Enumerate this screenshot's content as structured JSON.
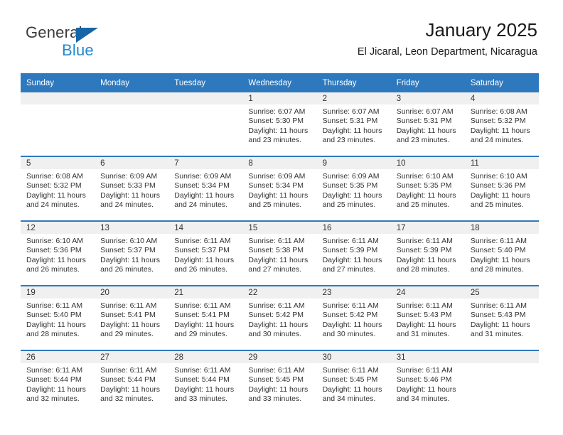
{
  "brand": {
    "name_part1": "General",
    "name_part2": "Blue",
    "triangle_icon": "brand-triangle-icon",
    "accent_color": "#1f88d4"
  },
  "header": {
    "title": "January 2025",
    "subtitle": "El Jicaral, Leon Department, Nicaragua"
  },
  "theme": {
    "header_bg": "#2e79bd",
    "header_text": "#ffffff",
    "daynum_band_bg": "#f0f0f0",
    "cell_bg": "#ffffff",
    "body_text": "#333333"
  },
  "weekday_headers": [
    "Sunday",
    "Monday",
    "Tuesday",
    "Wednesday",
    "Thursday",
    "Friday",
    "Saturday"
  ],
  "weeks": [
    [
      {
        "day": "",
        "sunrise": "",
        "sunset": "",
        "daylight_line1": "",
        "daylight_line2": "",
        "empty": true
      },
      {
        "day": "",
        "sunrise": "",
        "sunset": "",
        "daylight_line1": "",
        "daylight_line2": "",
        "empty": true
      },
      {
        "day": "",
        "sunrise": "",
        "sunset": "",
        "daylight_line1": "",
        "daylight_line2": "",
        "empty": true
      },
      {
        "day": "1",
        "sunrise": "Sunrise: 6:07 AM",
        "sunset": "Sunset: 5:30 PM",
        "daylight_line1": "Daylight: 11 hours",
        "daylight_line2": "and 23 minutes."
      },
      {
        "day": "2",
        "sunrise": "Sunrise: 6:07 AM",
        "sunset": "Sunset: 5:31 PM",
        "daylight_line1": "Daylight: 11 hours",
        "daylight_line2": "and 23 minutes."
      },
      {
        "day": "3",
        "sunrise": "Sunrise: 6:07 AM",
        "sunset": "Sunset: 5:31 PM",
        "daylight_line1": "Daylight: 11 hours",
        "daylight_line2": "and 23 minutes."
      },
      {
        "day": "4",
        "sunrise": "Sunrise: 6:08 AM",
        "sunset": "Sunset: 5:32 PM",
        "daylight_line1": "Daylight: 11 hours",
        "daylight_line2": "and 24 minutes."
      }
    ],
    [
      {
        "day": "5",
        "sunrise": "Sunrise: 6:08 AM",
        "sunset": "Sunset: 5:32 PM",
        "daylight_line1": "Daylight: 11 hours",
        "daylight_line2": "and 24 minutes."
      },
      {
        "day": "6",
        "sunrise": "Sunrise: 6:09 AM",
        "sunset": "Sunset: 5:33 PM",
        "daylight_line1": "Daylight: 11 hours",
        "daylight_line2": "and 24 minutes."
      },
      {
        "day": "7",
        "sunrise": "Sunrise: 6:09 AM",
        "sunset": "Sunset: 5:34 PM",
        "daylight_line1": "Daylight: 11 hours",
        "daylight_line2": "and 24 minutes."
      },
      {
        "day": "8",
        "sunrise": "Sunrise: 6:09 AM",
        "sunset": "Sunset: 5:34 PM",
        "daylight_line1": "Daylight: 11 hours",
        "daylight_line2": "and 25 minutes."
      },
      {
        "day": "9",
        "sunrise": "Sunrise: 6:09 AM",
        "sunset": "Sunset: 5:35 PM",
        "daylight_line1": "Daylight: 11 hours",
        "daylight_line2": "and 25 minutes."
      },
      {
        "day": "10",
        "sunrise": "Sunrise: 6:10 AM",
        "sunset": "Sunset: 5:35 PM",
        "daylight_line1": "Daylight: 11 hours",
        "daylight_line2": "and 25 minutes."
      },
      {
        "day": "11",
        "sunrise": "Sunrise: 6:10 AM",
        "sunset": "Sunset: 5:36 PM",
        "daylight_line1": "Daylight: 11 hours",
        "daylight_line2": "and 25 minutes."
      }
    ],
    [
      {
        "day": "12",
        "sunrise": "Sunrise: 6:10 AM",
        "sunset": "Sunset: 5:36 PM",
        "daylight_line1": "Daylight: 11 hours",
        "daylight_line2": "and 26 minutes."
      },
      {
        "day": "13",
        "sunrise": "Sunrise: 6:10 AM",
        "sunset": "Sunset: 5:37 PM",
        "daylight_line1": "Daylight: 11 hours",
        "daylight_line2": "and 26 minutes."
      },
      {
        "day": "14",
        "sunrise": "Sunrise: 6:11 AM",
        "sunset": "Sunset: 5:37 PM",
        "daylight_line1": "Daylight: 11 hours",
        "daylight_line2": "and 26 minutes."
      },
      {
        "day": "15",
        "sunrise": "Sunrise: 6:11 AM",
        "sunset": "Sunset: 5:38 PM",
        "daylight_line1": "Daylight: 11 hours",
        "daylight_line2": "and 27 minutes."
      },
      {
        "day": "16",
        "sunrise": "Sunrise: 6:11 AM",
        "sunset": "Sunset: 5:39 PM",
        "daylight_line1": "Daylight: 11 hours",
        "daylight_line2": "and 27 minutes."
      },
      {
        "day": "17",
        "sunrise": "Sunrise: 6:11 AM",
        "sunset": "Sunset: 5:39 PM",
        "daylight_line1": "Daylight: 11 hours",
        "daylight_line2": "and 28 minutes."
      },
      {
        "day": "18",
        "sunrise": "Sunrise: 6:11 AM",
        "sunset": "Sunset: 5:40 PM",
        "daylight_line1": "Daylight: 11 hours",
        "daylight_line2": "and 28 minutes."
      }
    ],
    [
      {
        "day": "19",
        "sunrise": "Sunrise: 6:11 AM",
        "sunset": "Sunset: 5:40 PM",
        "daylight_line1": "Daylight: 11 hours",
        "daylight_line2": "and 28 minutes."
      },
      {
        "day": "20",
        "sunrise": "Sunrise: 6:11 AM",
        "sunset": "Sunset: 5:41 PM",
        "daylight_line1": "Daylight: 11 hours",
        "daylight_line2": "and 29 minutes."
      },
      {
        "day": "21",
        "sunrise": "Sunrise: 6:11 AM",
        "sunset": "Sunset: 5:41 PM",
        "daylight_line1": "Daylight: 11 hours",
        "daylight_line2": "and 29 minutes."
      },
      {
        "day": "22",
        "sunrise": "Sunrise: 6:11 AM",
        "sunset": "Sunset: 5:42 PM",
        "daylight_line1": "Daylight: 11 hours",
        "daylight_line2": "and 30 minutes."
      },
      {
        "day": "23",
        "sunrise": "Sunrise: 6:11 AM",
        "sunset": "Sunset: 5:42 PM",
        "daylight_line1": "Daylight: 11 hours",
        "daylight_line2": "and 30 minutes."
      },
      {
        "day": "24",
        "sunrise": "Sunrise: 6:11 AM",
        "sunset": "Sunset: 5:43 PM",
        "daylight_line1": "Daylight: 11 hours",
        "daylight_line2": "and 31 minutes."
      },
      {
        "day": "25",
        "sunrise": "Sunrise: 6:11 AM",
        "sunset": "Sunset: 5:43 PM",
        "daylight_line1": "Daylight: 11 hours",
        "daylight_line2": "and 31 minutes."
      }
    ],
    [
      {
        "day": "26",
        "sunrise": "Sunrise: 6:11 AM",
        "sunset": "Sunset: 5:44 PM",
        "daylight_line1": "Daylight: 11 hours",
        "daylight_line2": "and 32 minutes."
      },
      {
        "day": "27",
        "sunrise": "Sunrise: 6:11 AM",
        "sunset": "Sunset: 5:44 PM",
        "daylight_line1": "Daylight: 11 hours",
        "daylight_line2": "and 32 minutes."
      },
      {
        "day": "28",
        "sunrise": "Sunrise: 6:11 AM",
        "sunset": "Sunset: 5:44 PM",
        "daylight_line1": "Daylight: 11 hours",
        "daylight_line2": "and 33 minutes."
      },
      {
        "day": "29",
        "sunrise": "Sunrise: 6:11 AM",
        "sunset": "Sunset: 5:45 PM",
        "daylight_line1": "Daylight: 11 hours",
        "daylight_line2": "and 33 minutes."
      },
      {
        "day": "30",
        "sunrise": "Sunrise: 6:11 AM",
        "sunset": "Sunset: 5:45 PM",
        "daylight_line1": "Daylight: 11 hours",
        "daylight_line2": "and 34 minutes."
      },
      {
        "day": "31",
        "sunrise": "Sunrise: 6:11 AM",
        "sunset": "Sunset: 5:46 PM",
        "daylight_line1": "Daylight: 11 hours",
        "daylight_line2": "and 34 minutes."
      },
      {
        "day": "",
        "sunrise": "",
        "sunset": "",
        "daylight_line1": "",
        "daylight_line2": "",
        "empty": true
      }
    ]
  ]
}
